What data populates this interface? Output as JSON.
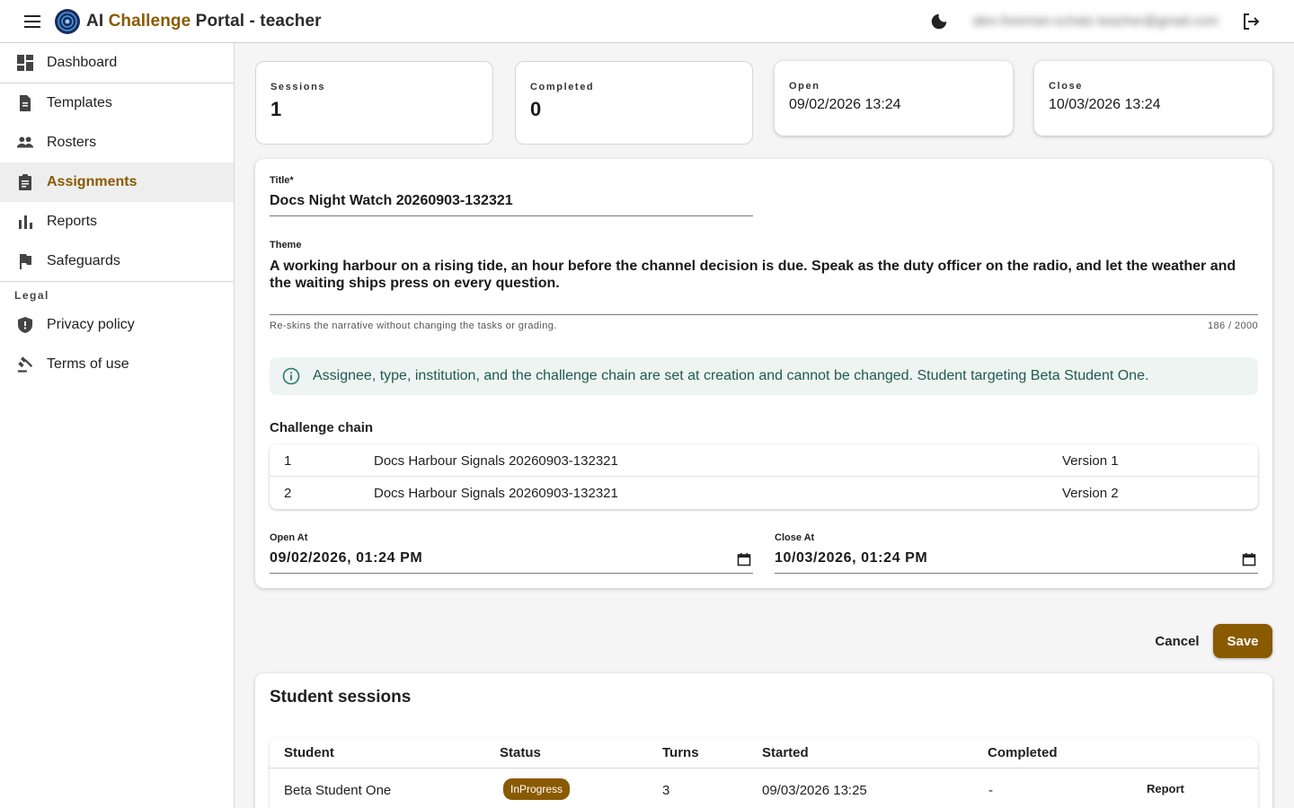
{
  "header": {
    "title_prefix": "AI ",
    "title_accent": "Challenge",
    "title_suffix": " Portal - teacher",
    "user_email": "alex.freeman-schatz-teacher@gmail.com"
  },
  "sidebar": {
    "items": [
      {
        "label": "Dashboard",
        "icon": "dashboard-icon"
      },
      {
        "label": "Templates",
        "icon": "document-icon"
      },
      {
        "label": "Rosters",
        "icon": "people-icon"
      },
      {
        "label": "Assignments",
        "icon": "clipboard-icon",
        "active": true
      },
      {
        "label": "Reports",
        "icon": "bar-chart-icon"
      },
      {
        "label": "Safeguards",
        "icon": "flag-icon"
      }
    ],
    "legal_section": "Legal",
    "legal_items": [
      {
        "label": "Privacy policy",
        "icon": "shield-icon"
      },
      {
        "label": "Terms of use",
        "icon": "gavel-icon"
      }
    ]
  },
  "stats": {
    "sessions_label": "Sessions",
    "sessions_value": "1",
    "completed_label": "Completed",
    "completed_value": "0",
    "open_label": "Open",
    "open_value": "09/02/2026 13:24",
    "close_label": "Close",
    "close_value": "10/03/2026 13:24"
  },
  "form": {
    "title_label": "Title*",
    "title_value": "Docs Night Watch 20260903-132321",
    "theme_label": "Theme",
    "theme_value": "A working harbour on a rising tide, an hour before the channel decision is due. Speak as the duty officer on the radio, and let the weather and the waiting ships press on every question.",
    "theme_helper": "Re-skins the narrative without changing the tasks or grading.",
    "theme_counter": "186 / 2000",
    "info_text": "Assignee, type, institution, and the challenge chain are set at creation and cannot be changed. Student targeting Beta Student One.",
    "chain_title": "Challenge chain",
    "chain": [
      {
        "index": "1",
        "name": "Docs Harbour Signals 20260903-132321",
        "version": "Version 1"
      },
      {
        "index": "2",
        "name": "Docs Harbour Signals 20260903-132321",
        "version": "Version 2"
      }
    ],
    "open_at_label": "Open At",
    "open_at_value": "09/02/2026, 01:24 PM",
    "close_at_label": "Close At",
    "close_at_value": "10/03/2026, 01:24 PM"
  },
  "actions": {
    "cancel_label": "Cancel",
    "save_label": "Save"
  },
  "sessions": {
    "title": "Student sessions",
    "columns": [
      "Student",
      "Status",
      "Turns",
      "Started",
      "Completed"
    ],
    "rows": [
      {
        "student": "Beta Student One",
        "status": "InProgress",
        "turns": "3",
        "started": "09/03/2026 13:25",
        "completed": "-",
        "action": "Report"
      }
    ]
  },
  "colors": {
    "accent": "#8a5a00",
    "info_bg": "#eef4f1",
    "info_text": "#1f5a52"
  }
}
